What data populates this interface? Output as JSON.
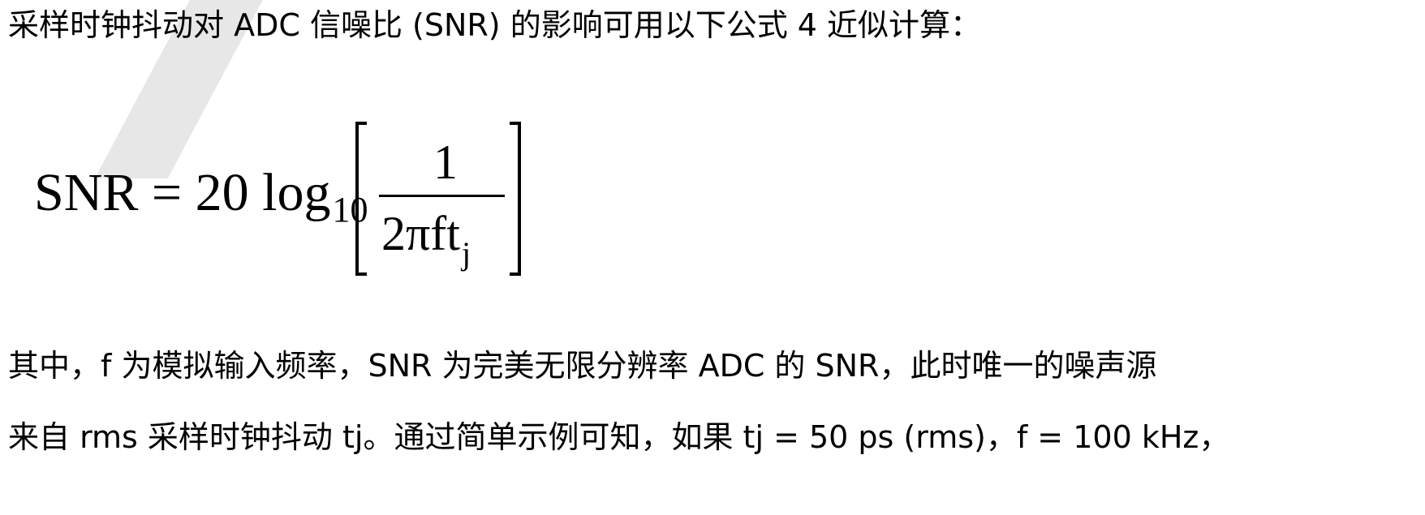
{
  "paragraph_intro": "采样时钟抖动对 ADC 信噪比 (SNR) 的影响可用以下公式 4 近似计算：",
  "formula": {
    "lhs": "SNR = 20 log",
    "log_subscript": "10",
    "numerator": "1",
    "denominator": "2πft",
    "denominator_subscript": "j"
  },
  "paragraph_line1": "其中，f 为模拟输入频率，SNR 为完美无限分辨率 ADC 的 SNR，此时唯一的噪声源",
  "paragraph_line2": "来自 rms 采样时钟抖动 tj。通过简单示例可知，如果 tj = 50 ps (rms)，f = 100 kHz，"
}
